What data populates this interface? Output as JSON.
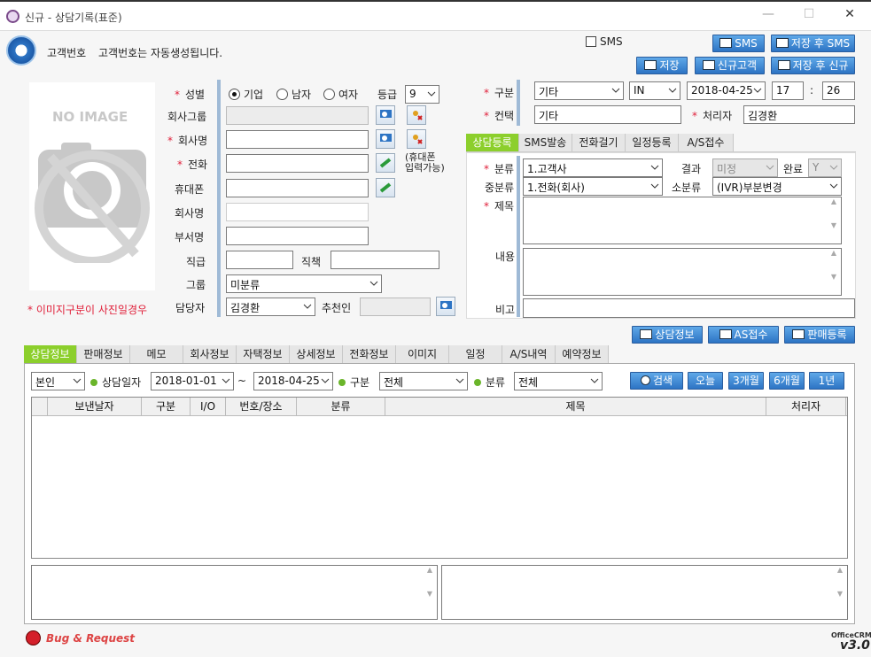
{
  "window": {
    "title": "신규 - 상담기록(표준)",
    "min": "—",
    "max": "☐",
    "close": "✕"
  },
  "header": {
    "cust_no_label": "고객번호",
    "cust_no_value": "고객번호는 자동생성됩니다.",
    "sms_check": "SMS",
    "btn_sms": "SMS",
    "btn_save_sms": "저장 후 SMS",
    "btn_save": "저장",
    "btn_new_customer": "신규고객",
    "btn_save_new": "저장 후 신규"
  },
  "photo": {
    "placeholder": "NO IMAGE",
    "note": "* 이미지구분이 사진일경우"
  },
  "customer": {
    "gender_label": "성별",
    "gender_options": [
      "기업",
      "남자",
      "여자"
    ],
    "grade_label": "등급",
    "grade_value": "9",
    "company_group_label": "회사그룹",
    "company_name_label": "회사명",
    "phone_label": "전화",
    "phone_note": "(휴대폰\n입력가능)",
    "mobile_label": "휴대폰",
    "company_name2_label": "회사명",
    "dept_label": "부서명",
    "rank_label": "직급",
    "title_label": "직책",
    "group_label": "그룹",
    "group_value": "미분류",
    "manager_label": "담당자",
    "manager_value": "김경환",
    "recommender_label": "추천인"
  },
  "consult": {
    "type_label": "구분",
    "type_value": "기타",
    "io_value": "IN",
    "date_value": "2018-04-25",
    "hour": "17",
    "colon": ":",
    "minute": "26",
    "contact_label": "컨택",
    "contact_value": "기타",
    "handler_label": "처리자",
    "handler_value": "김경환",
    "tabs": [
      "상담등록",
      "SMS발송",
      "전화걸기",
      "일정등록",
      "A/S접수"
    ],
    "cat_label": "분류",
    "cat_value": "1.고객사",
    "result_label": "결과",
    "result_value": "미정",
    "done_label": "완료",
    "done_value": "Y",
    "mid_label": "중분류",
    "mid_value": "1.전화(회사)",
    "sub_label": "소분류",
    "sub_value": "(IVR)부분변경",
    "subject_label": "제목",
    "content_label": "내용",
    "remark_label": "비고",
    "btn_consult_info": "상담정보",
    "btn_as": "AS접수",
    "btn_sales": "판매등록"
  },
  "bottom": {
    "tabs": [
      "상담정보",
      "판매정보",
      "메모",
      "회사정보",
      "자택정보",
      "상세정보",
      "전화정보",
      "이미지",
      "일정",
      "A/S내역",
      "예약정보"
    ],
    "scope_value": "본인",
    "date_label": "상담일자",
    "date_from": "2018-01-01",
    "tilde": "~",
    "date_to": "2018-04-25",
    "type_label": "구분",
    "type_value": "전체",
    "cat_label": "분류",
    "cat_value": "전체",
    "btn_search": "검색",
    "btn_today": "오늘",
    "btn_3m": "3개월",
    "btn_6m": "6개월",
    "btn_1y": "1년",
    "columns": [
      "보낸날자",
      "구분",
      "I/O",
      "번호/장소",
      "분류",
      "제목",
      "처리자"
    ]
  },
  "footer": {
    "bug": "Bug & Request",
    "brand_small": "OfficeCRM",
    "version": "v3.0"
  }
}
